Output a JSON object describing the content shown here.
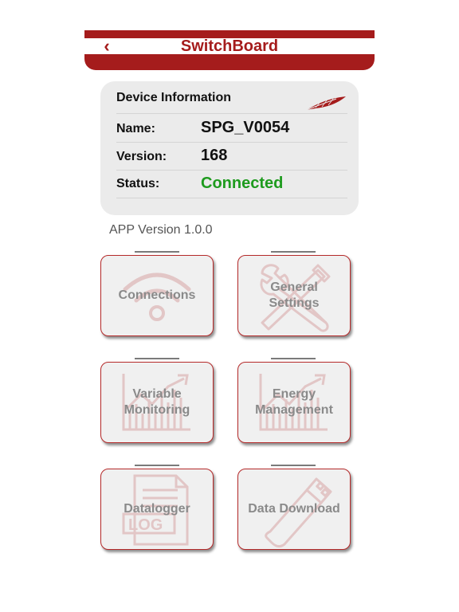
{
  "header": {
    "title": "SwitchBoard",
    "back_icon": "chevron-left-icon"
  },
  "device_info": {
    "heading": "Device Information",
    "rows": [
      {
        "label": "Name:",
        "value": "SPG_V0054"
      },
      {
        "label": "Version:",
        "value": "168"
      },
      {
        "label": "Status:",
        "value": "Connected"
      }
    ],
    "status_color": "#1e9b1e"
  },
  "app_version": "APP Version 1.0.0",
  "tiles": [
    {
      "label": "Connections",
      "icon": "wifi-icon"
    },
    {
      "label": "General\nSettings",
      "icon": "tools-icon"
    },
    {
      "label": "Variable\nMonitoring",
      "icon": "chart-icon"
    },
    {
      "label": "Energy\nManagement",
      "icon": "chart-icon"
    },
    {
      "label": "Datalogger",
      "icon": "log-file-icon"
    },
    {
      "label": "Data Download",
      "icon": "usb-drive-icon"
    }
  ],
  "colors": {
    "accent": "#a51c1c",
    "tile_border": "#b52a2a",
    "icon_faint": "#e2c6c6"
  }
}
